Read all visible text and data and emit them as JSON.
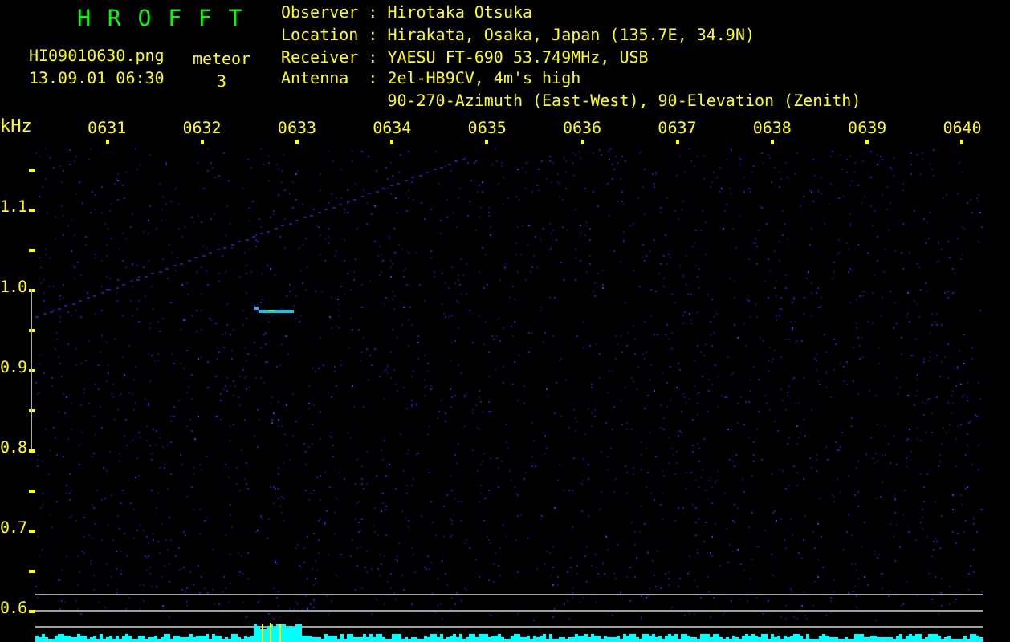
{
  "header": {
    "title": "H R O F F T",
    "file_name": "HI09010630.png",
    "timestamp": "13.09.01 06:30",
    "meteor_label": "meteor",
    "meteor_count": "3"
  },
  "info": [
    {
      "label": "Observer",
      "separator": ":",
      "value": "Hirotaka Otsuka"
    },
    {
      "label": "Location",
      "separator": ":",
      "value": "Hirakata, Osaka, Japan (135.7E, 34.9N)"
    },
    {
      "label": "Receiver",
      "separator": ":",
      "value": "YAESU FT-690 53.749MHz, USB"
    },
    {
      "label": "Antenna",
      "separator": ":",
      "value": "2el-HB9CV, 4m's high"
    },
    {
      "value": "90-270-Azimuth (East-West), 90-Elevation (Zenith)"
    }
  ],
  "plot": {
    "unit": "kHz",
    "time_labels": [
      "0631",
      "0632",
      "0633",
      "0634",
      "0635",
      "0636",
      "0637",
      "0638",
      "0639",
      "0640"
    ],
    "freq_labels": [
      "1.1",
      "1.0",
      "0.9",
      "0.8",
      "0.7",
      "0.6"
    ]
  }
}
